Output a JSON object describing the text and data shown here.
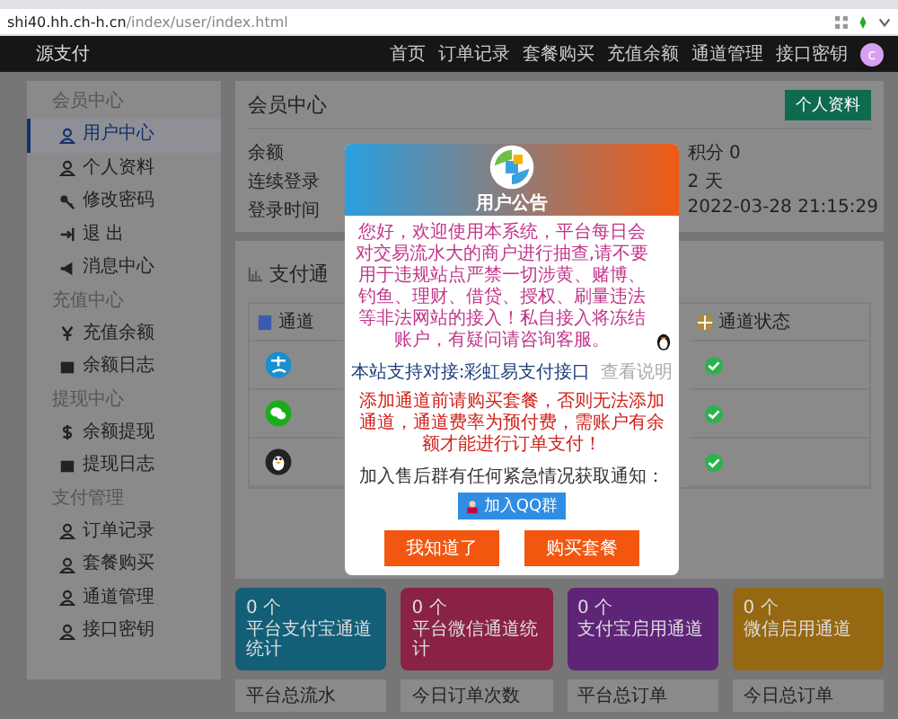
{
  "browser": {
    "host": "shi40.hh.ch-h.cn",
    "path": "/index/user/index.html"
  },
  "nav": {
    "brand": "源支付",
    "links": [
      "首页",
      "订单记录",
      "套餐购买",
      "充值余额",
      "通道管理",
      "接口密钥"
    ],
    "avatar": "c"
  },
  "sidebar": {
    "groups": [
      {
        "title": "会员中心",
        "items": [
          {
            "label": "用户中心",
            "selected": true
          },
          {
            "label": "个人资料",
            "selected": false
          },
          {
            "label": "修改密码",
            "selected": false
          },
          {
            "label": "退 出",
            "selected": false
          }
        ]
      },
      {
        "items": [
          {
            "label": "消息中心",
            "selected": false
          }
        ]
      },
      {
        "title": "充值中心",
        "items": [
          {
            "label": "充值余额",
            "selected": false
          },
          {
            "label": "余额日志",
            "selected": false
          }
        ]
      },
      {
        "title": "提现中心",
        "items": [
          {
            "label": "余额提现",
            "selected": false
          },
          {
            "label": "提现日志",
            "selected": false
          }
        ]
      },
      {
        "title": "支付管理",
        "items": [
          {
            "label": "订单记录",
            "selected": false
          },
          {
            "label": "套餐购买",
            "selected": false
          },
          {
            "label": "通道管理",
            "selected": false
          },
          {
            "label": "接口密钥",
            "selected": false
          }
        ]
      }
    ]
  },
  "member_panel": {
    "title": "会员中心",
    "button": "个人资料",
    "left_labels": [
      "余额",
      "连续登录",
      "登录时间"
    ],
    "right_values": [
      "积分 0",
      "2 天",
      "2022-03-28 21:15:29"
    ]
  },
  "channel_panel": {
    "title": "支付通",
    "columns": [
      "通道",
      "通道状态"
    ],
    "rows": [
      {
        "enabled": true
      },
      {
        "enabled": true
      },
      {
        "enabled": true
      }
    ]
  },
  "stat_cards": [
    {
      "count": "0 个",
      "label": "平台支付宝通道统计",
      "color": "#135f78"
    },
    {
      "count": "0 个",
      "label": "平台微信通道统计",
      "color": "#8a2245"
    },
    {
      "count": "0 个",
      "label": "支付宝启用通道",
      "color": "#5e2478"
    },
    {
      "count": "0 个",
      "label": "微信启用通道",
      "color": "#966812"
    }
  ],
  "bottom_cards": [
    "平台总流水",
    "今日订单次数",
    "平台总订单",
    "今日总订单"
  ],
  "modal": {
    "title": "用户公告",
    "notice": "您好，欢迎使用本系统，平台每日会对交易流水大的商户进行抽查,请不要用于违规站点严禁一切涉黄、赌博、钓鱼、理财、借贷、授权、刷量违法等非法网站的接入！私自接入将冻结账户，有疑问请咨询客服。",
    "support": "本站支持对接:彩虹易支付接口",
    "support_link": "查看说明",
    "warning": "添加通道前请购买套餐，否则无法添加通道，通道费率为预付费，需账户有余额才能进行订单支付！",
    "join_text": "加入售后群有任何紧急情况获取通知：",
    "join_button": "加入QQ群",
    "buttons": [
      "我知道了",
      "购买套餐"
    ]
  }
}
